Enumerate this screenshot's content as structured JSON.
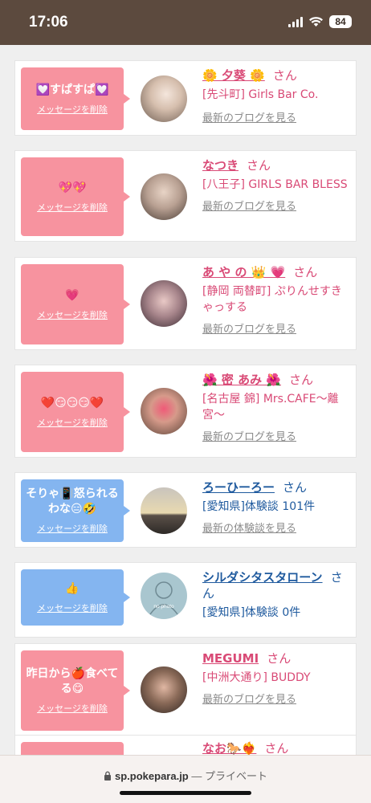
{
  "status_bar": {
    "time": "17:06",
    "battery": "84"
  },
  "delete_label": "メッセージを削除",
  "messages": [
    {
      "message": "💟すぱすぱ💟",
      "name": "🌼 夕葵 🌼",
      "san": "さん",
      "shop": "[先斗町] Girls Bar Co.",
      "link": "最新のブログを見る",
      "bubble_color": "#f7939f"
    },
    {
      "message": "💖💖",
      "name": "なつき",
      "san": "さん",
      "shop": "[八王子] GIRLS BAR BLESS",
      "link": "最新のブログを見る",
      "bubble_color": "#f7939f"
    },
    {
      "message": "💗",
      "name": "あ や の 👑 💗",
      "san": "さん",
      "shop": "[静岡 両替町] ぷりんせすきゃっする",
      "link": "最新のブログを見る",
      "bubble_color": "#f7939f"
    },
    {
      "message": "❤️😏😏😏❤️",
      "name": "🌺 密 あみ 🌺",
      "san": "さん",
      "shop": "[名古屋 錦] Mrs.CAFE〜離宮〜",
      "link": "最新のブログを見る",
      "bubble_color": "#f7939f"
    },
    {
      "message": "そりゃ📳怒られるわな😑🤣",
      "name": "ろーひーろー",
      "san": "さん",
      "shop": "[愛知県]体験談 101件",
      "link": "最新の体験談を見る",
      "bubble_color": "#84b5f0"
    },
    {
      "message": "👍",
      "name": "シルダシタスタローン",
      "san": "さん",
      "shop": "[愛知県]体験談 0件",
      "link": "",
      "bubble_color": "#84b5f0"
    },
    {
      "message": "昨日から🍎食べてる😋",
      "name": "MEGUMI",
      "san": "さん",
      "shop": "[中洲大通り] BUDDY",
      "link": "最新のブログを見る",
      "bubble_color": "#f7939f"
    },
    {
      "message": "",
      "name": "なお🐎❤️‍🔥",
      "san": "さん",
      "shop": "",
      "link": "",
      "bubble_color": "#f7939f"
    }
  ],
  "avatar_placeholder_text": "no photo",
  "footer": {
    "domain": "sp.pokepara.jp",
    "private": "— プライベート"
  }
}
